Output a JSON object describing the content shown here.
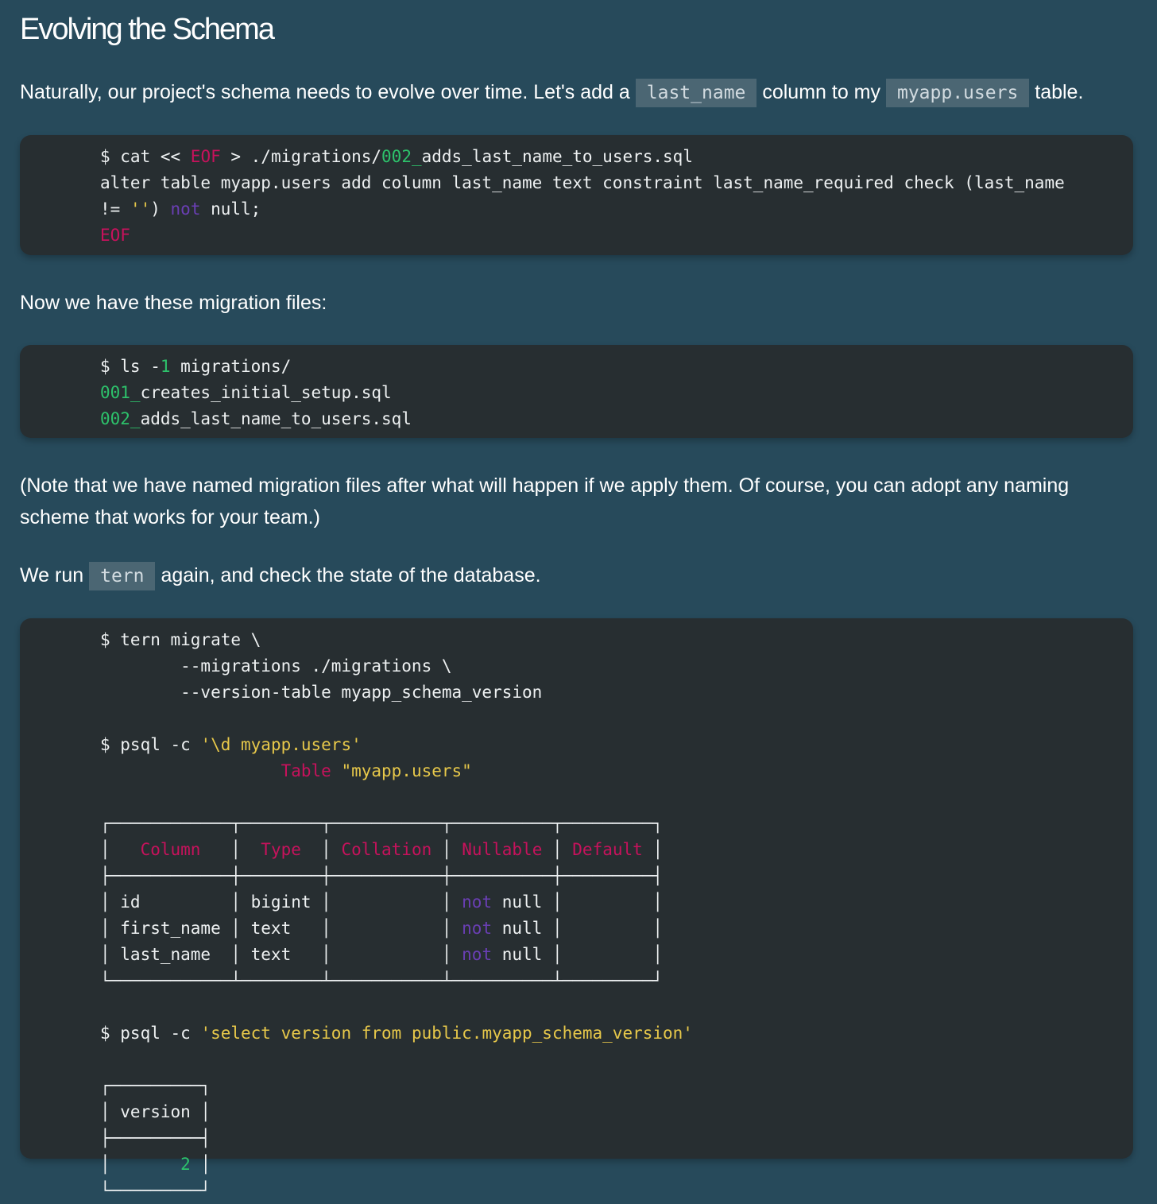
{
  "heading": "Evolving the Schema",
  "p1": {
    "text_a": "Naturally, our project's schema needs to evolve over time. Let's add a",
    "code_a": "last_name",
    "text_b": "column to my",
    "code_b": "myapp.users",
    "text_c": "table."
  },
  "code1": {
    "l1_a": "$ cat << ",
    "l1_eof": "EOF",
    "l1_b": " > ./migrations/",
    "l1_num": "002_",
    "l1_c": "adds_last_name_to_users.sql",
    "l2": "alter table myapp.users add column last_name text constraint last_name_required check (last_name",
    "l3_a": "!= ",
    "l3_str": "''",
    "l3_b": ") ",
    "l3_not": "not",
    "l3_c": " null;",
    "l4": "EOF"
  },
  "p2": "Now we have these migration files:",
  "code2": {
    "l1_a": "$ ls -",
    "l1_num": "1",
    "l1_b": " migrations/",
    "l2_num": "001_",
    "l2_b": "creates_initial_setup.sql",
    "l3_num": "002_",
    "l3_b": "adds_last_name_to_users.sql"
  },
  "p3": "(Note that we have named migration files after what will happen if we apply them. Of course, you can adopt any naming scheme that works for your team.)",
  "p4": {
    "text_a": "We run",
    "code_a": "tern",
    "text_b": "again, and check the state of the database."
  },
  "code3": {
    "l1": "$ tern migrate \\",
    "l2": "        --migrations ./migrations \\",
    "l3": "        --version-table myapp_schema_version",
    "l5_a": "$ psql -c ",
    "l5_str": "'\\d myapp.users'",
    "l6_pad": "                  ",
    "l6_kw": "Table",
    "l6_sp": " ",
    "l6_str": "\"myapp.users\"",
    "t_top": "┌────────────┬────────┬───────────┬──────────┬─────────┐",
    "t_h_1": "│   ",
    "t_h_column": "Column",
    "t_h_2": "   │  ",
    "t_h_type": "Type",
    "t_h_3": "  │ ",
    "t_h_collation": "Collation",
    "t_h_4": " │ ",
    "t_h_nullable": "Nullable",
    "t_h_5": " │ ",
    "t_h_default": "Default",
    "t_h_6": " │",
    "t_sep": "├────────────┼────────┼───────────┼──────────┼─────────┤",
    "r1_a": "│ id         │ bigint │           │ ",
    "r1_not": "not",
    "r1_b": " null │         │",
    "r2_a": "│ first_name │ text   │           │ ",
    "r2_not": "not",
    "r2_b": " null │         │",
    "r3_a": "│ last_name  │ text   │           │ ",
    "r3_not": "not",
    "r3_b": " null │         │",
    "t_bot": "└────────────┴────────┴───────────┴──────────┴─────────┘",
    "q_a": "$ psql -c ",
    "q_str": "'select version from public.myapp_schema_version'",
    "v_top": "┌─────────┐",
    "v_head": "│ version │",
    "v_sep": "├─────────┤",
    "v_row_a": "│       ",
    "v_val": "2",
    "v_row_b": " │",
    "v_bot": "└─────────┘"
  }
}
